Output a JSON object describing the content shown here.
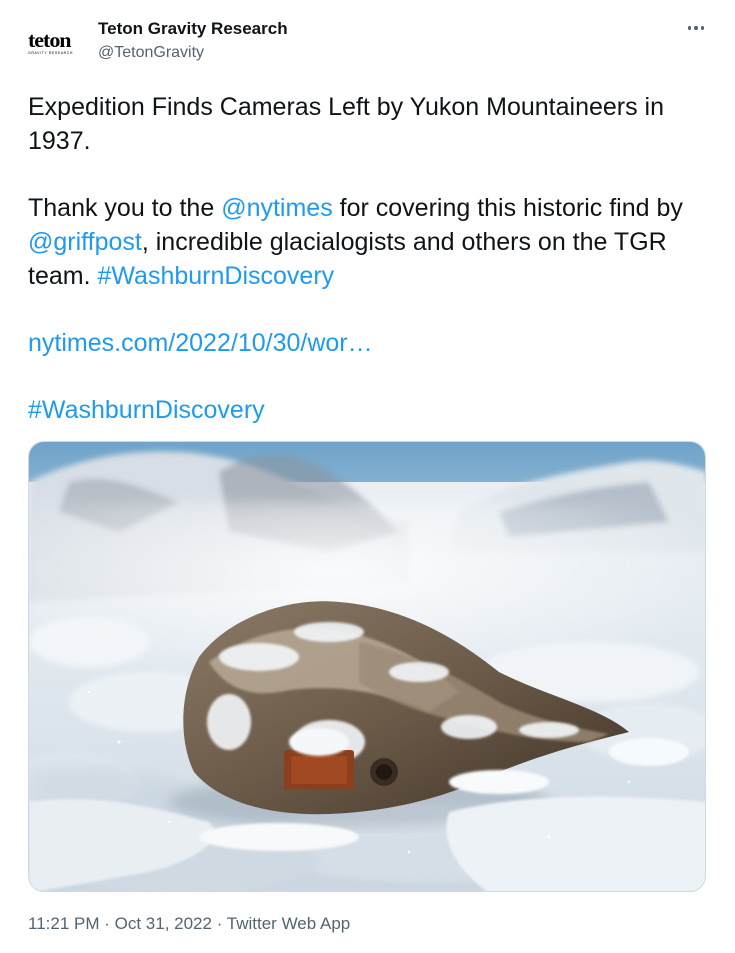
{
  "author": {
    "display_name": "Teton Gravity Research",
    "handle": "@TetonGravity",
    "logo_text": "teton",
    "logo_subtext": "GRAVITY RESEARCH"
  },
  "tweet": {
    "line1": "Expedition Finds Cameras Left by Yukon Mountaineers in 1937.",
    "p2_part1": "Thank you to the ",
    "p2_mention1": "@nytimes",
    "p2_part2": " for covering this historic find by ",
    "p2_mention2": "@griffpost",
    "p2_part3": ", incredible glacialogists and others on the TGR team. ",
    "p2_hashtag": "#WashburnDiscovery",
    "url": "nytimes.com/2022/10/30/wor…",
    "hashtag": "#WashburnDiscovery"
  },
  "meta": {
    "time": "11:21 PM",
    "sep1": " · ",
    "date": "Oct 31, 2022",
    "sep2": " · ",
    "source": "Twitter Web App"
  },
  "icons": {
    "more": "more-horizontal-icon"
  },
  "colors": {
    "link": "#1d9bf0",
    "secondary_text": "#536471",
    "primary_text": "#0f1419"
  }
}
